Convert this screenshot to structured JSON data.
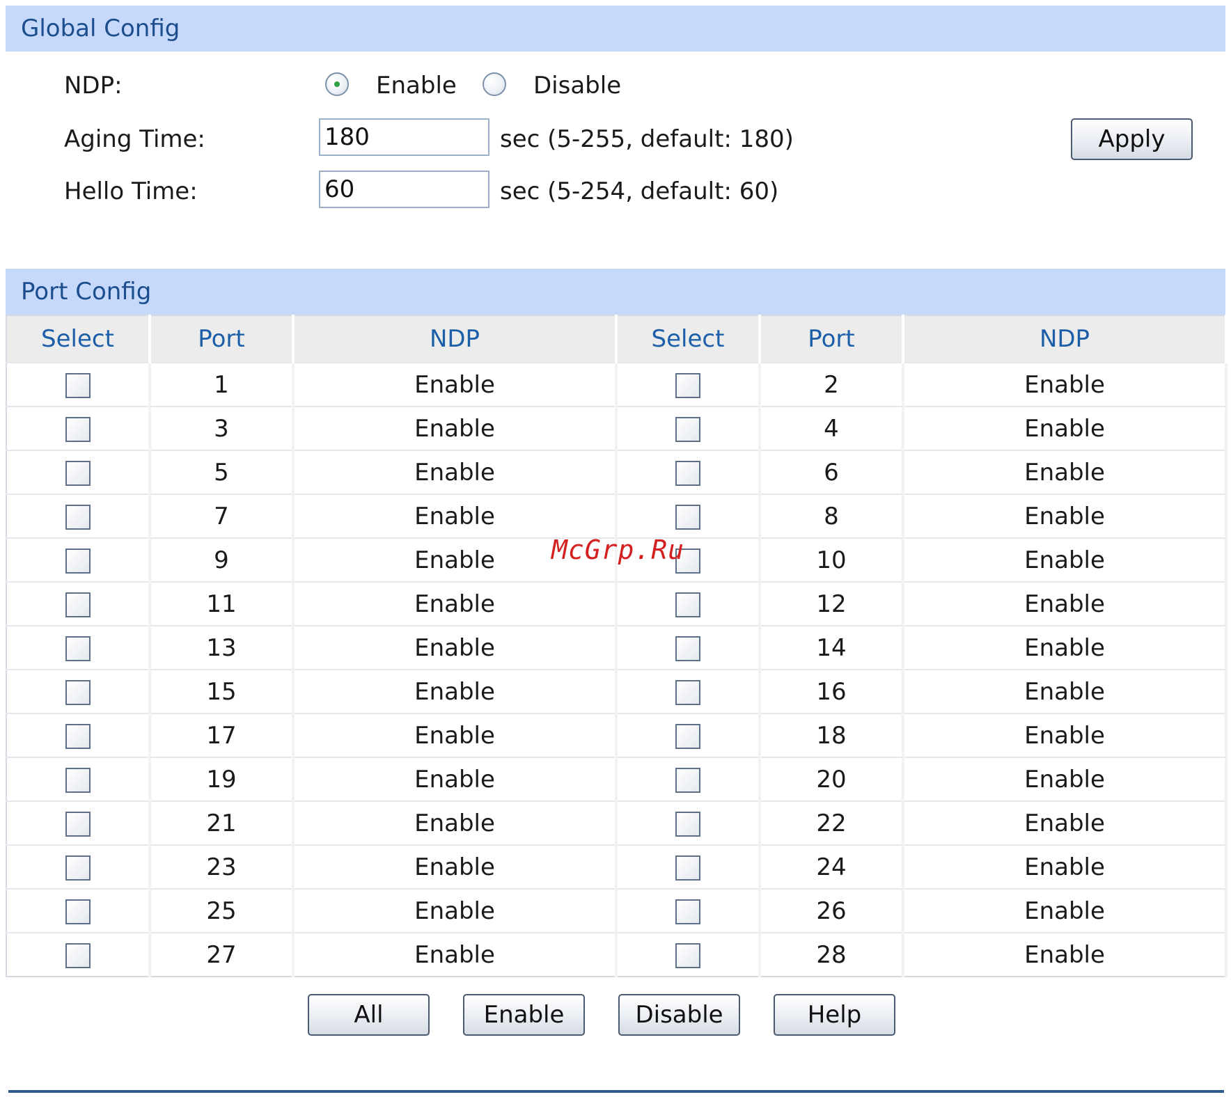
{
  "global_config": {
    "title": "Global Config",
    "ndp_label": "NDP:",
    "ndp_enable_label": "Enable",
    "ndp_disable_label": "Disable",
    "ndp_selected": "Enable",
    "aging_label": "Aging Time:",
    "aging_value": "180",
    "aging_hint": "sec (5-255, default: 180)",
    "hello_label": "Hello Time:",
    "hello_value": "60",
    "hello_hint": "sec (5-254, default: 60)",
    "apply_label": "Apply"
  },
  "port_config": {
    "title": "Port Config",
    "columns": [
      "Select",
      "Port",
      "NDP",
      "Select",
      "Port",
      "NDP"
    ],
    "rows": [
      {
        "left_port": "1",
        "left_ndp": "Enable",
        "right_port": "2",
        "right_ndp": "Enable"
      },
      {
        "left_port": "3",
        "left_ndp": "Enable",
        "right_port": "4",
        "right_ndp": "Enable"
      },
      {
        "left_port": "5",
        "left_ndp": "Enable",
        "right_port": "6",
        "right_ndp": "Enable"
      },
      {
        "left_port": "7",
        "left_ndp": "Enable",
        "right_port": "8",
        "right_ndp": "Enable"
      },
      {
        "left_port": "9",
        "left_ndp": "Enable",
        "right_port": "10",
        "right_ndp": "Enable"
      },
      {
        "left_port": "11",
        "left_ndp": "Enable",
        "right_port": "12",
        "right_ndp": "Enable"
      },
      {
        "left_port": "13",
        "left_ndp": "Enable",
        "right_port": "14",
        "right_ndp": "Enable"
      },
      {
        "left_port": "15",
        "left_ndp": "Enable",
        "right_port": "16",
        "right_ndp": "Enable"
      },
      {
        "left_port": "17",
        "left_ndp": "Enable",
        "right_port": "18",
        "right_ndp": "Enable"
      },
      {
        "left_port": "19",
        "left_ndp": "Enable",
        "right_port": "20",
        "right_ndp": "Enable"
      },
      {
        "left_port": "21",
        "left_ndp": "Enable",
        "right_port": "22",
        "right_ndp": "Enable"
      },
      {
        "left_port": "23",
        "left_ndp": "Enable",
        "right_port": "24",
        "right_ndp": "Enable"
      },
      {
        "left_port": "25",
        "left_ndp": "Enable",
        "right_port": "26",
        "right_ndp": "Enable"
      },
      {
        "left_port": "27",
        "left_ndp": "Enable",
        "right_port": "28",
        "right_ndp": "Enable"
      }
    ],
    "buttons": {
      "all": "All",
      "enable": "Enable",
      "disable": "Disable",
      "help": "Help"
    }
  },
  "watermark": "McGrp.Ru"
}
